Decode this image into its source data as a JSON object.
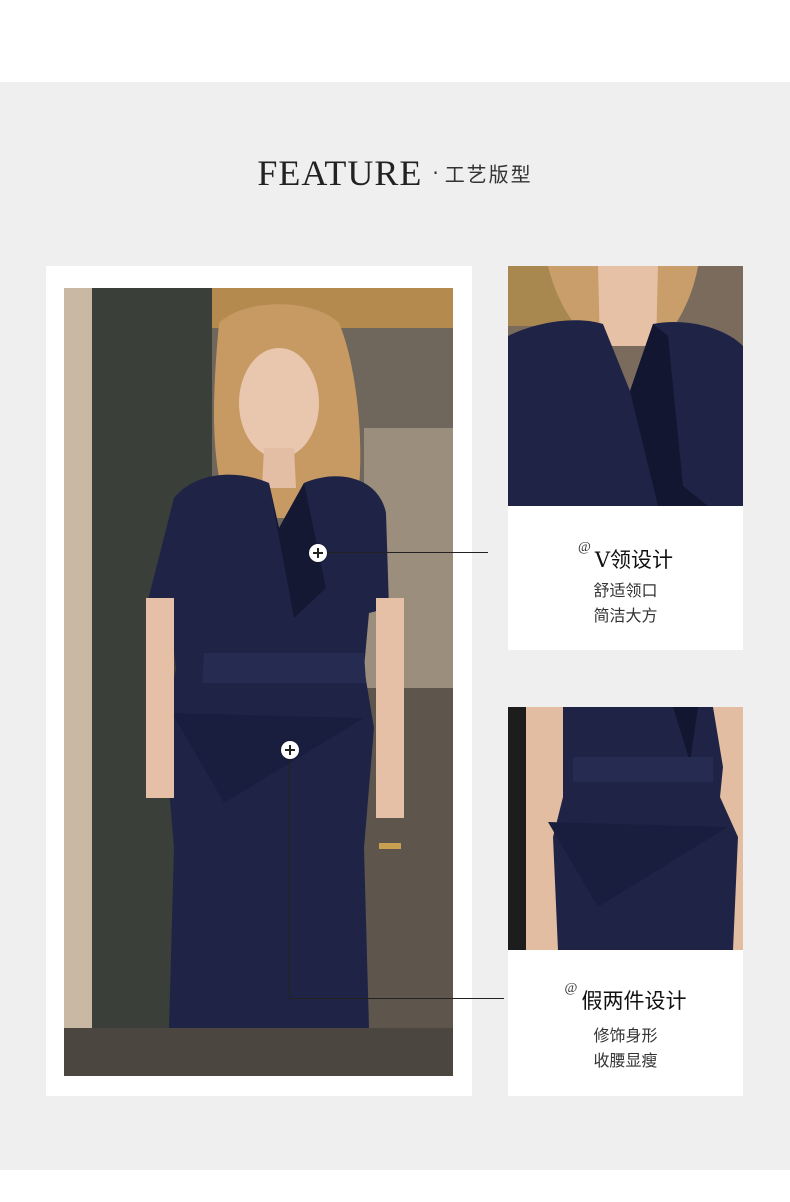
{
  "header": {
    "title_en": "FEATURE",
    "separator": "·",
    "title_cn": "工艺版型"
  },
  "features": [
    {
      "marker": "@",
      "title": "V领设计",
      "desc_line1": "舒适领口",
      "desc_line2": "简洁大方"
    },
    {
      "marker": "@",
      "title": "假两件设计",
      "desc_line1": "修饰身形",
      "desc_line2": "收腰显瘦"
    }
  ],
  "colors": {
    "panel_bg": "#efefef",
    "dress_navy": "#1f2447",
    "text_dark": "#222222"
  }
}
